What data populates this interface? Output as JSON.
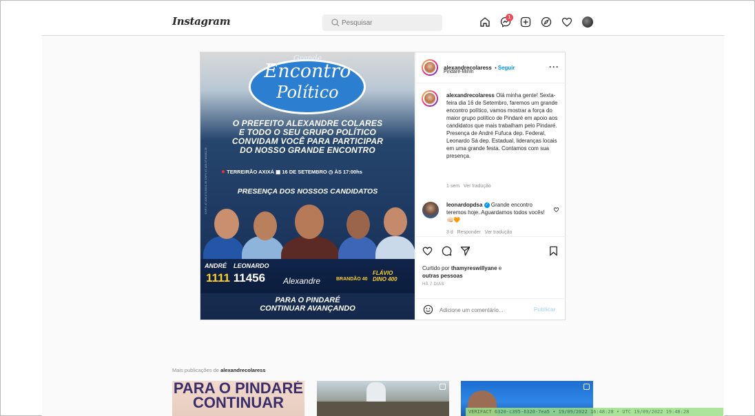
{
  "topbar": {
    "logo": "Instagram",
    "search_placeholder": "Pesquisar",
    "notification_count": "1"
  },
  "poster": {
    "title_small": "Grande",
    "title_line1": "Encontro",
    "title_line2": "Político",
    "side_text": "CNPJ: 47.425.071/0001-35    CNPJ 47.425.071/0001-35",
    "invite_lines": [
      "O PREFEITO ALEXANDRE COLARES",
      "E TODO O SEU GRUPO POLÍTICO",
      "CONVIDAM VOCÊ PARA PARTICIPAR",
      "DO NOSSO GRANDE ENCONTRO"
    ],
    "location": "TERREIRÃO AXIXÁ",
    "date": "16 DE SETEMBRO",
    "time": "ÀS 17:00hs",
    "presence": "PRESENÇA DOS NOSSOS CANDIDATOS",
    "name_andre": "ANDRÉ",
    "name_leonardo": "LEONARDO",
    "num_1": "1111",
    "num_2": "11456",
    "name_alexandre": "Alexandre",
    "brandao": "BRANDÃO 40",
    "flavio": "FLÁVIO",
    "dino": "DINO 400",
    "bottom_line1": "PARA O PINDARÉ",
    "bottom_line2": "CONTINUAR AVANÇANDO"
  },
  "post": {
    "author": "alexandrecolaress",
    "follow_label": "Seguir",
    "location": "Pindaré-Mirim",
    "more_label": "···",
    "caption_author": "alexandrecolaress",
    "caption_text": "Olá minha gente! Sexta-feira dia 16 de Setembro, faremos um grande encontro político, vamos mostrar a força do maior grupo político de Pindaré em apoio aos candidatos que mais trabalham pelo Pindaré. Presença de André Fufuca dep. Federal, Leonardo Sá dep. Estadual, lideranças locais em uma grande festa. Contamos com sua presença.",
    "caption_age": "1 sem",
    "caption_translate": "Ver tradução",
    "comment_author": "leonardopdsa",
    "comment_text": "Grande encontro teremos hoje. Aguardamos todos vocês! 👊🏻🧡",
    "comment_age": "3 d",
    "comment_reply": "Responder",
    "comment_translate": "Ver tradução",
    "liked_prefix": "Curtido por",
    "liked_user": "thamyreswillyane",
    "liked_and": "e",
    "liked_others": "outras pessoas",
    "posted_ago": "HÁ 7 DIAS",
    "add_comment_placeholder": "Adicione um comentário...",
    "publish_label": "Publicar"
  },
  "more_posts": {
    "label_prefix": "Mais publicações de",
    "label_user": "alexandrecolaress",
    "thumb1_text": "PARA O PINDARÉ CONTINUAR"
  },
  "stamp_text": "VERIFACT 6320-c395-6320-7ea5 • 19/09/2022 16:48:28 • UTC 19/09/2022 19:48:28"
}
